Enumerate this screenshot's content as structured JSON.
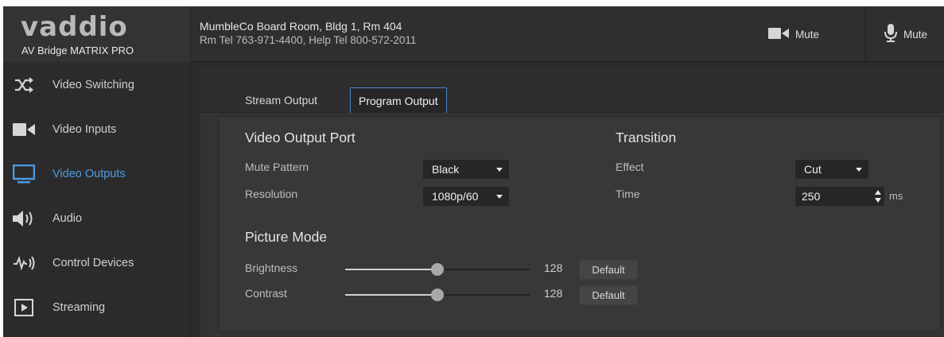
{
  "header": {
    "logo": "vaddio",
    "product": "AV Bridge MATRIX PRO",
    "room_name": "MumbleCo Board Room, Bldg 1, Rm 404",
    "room_phones": "Rm Tel 763-971-4400, Help Tel 800-572-2011",
    "video_mute_label": "Mute",
    "audio_mute_label": "Mute"
  },
  "sidebar": {
    "items": [
      {
        "label": "Video Switching",
        "icon": "shuffle-icon"
      },
      {
        "label": "Video Inputs",
        "icon": "video-camera-icon"
      },
      {
        "label": "Video Outputs",
        "icon": "monitor-icon",
        "active": true
      },
      {
        "label": "Audio",
        "icon": "speaker-icon"
      },
      {
        "label": "Control Devices",
        "icon": "signal-icon"
      },
      {
        "label": "Streaming",
        "icon": "play-box-icon"
      }
    ]
  },
  "tabs": {
    "stream_output": "Stream Output",
    "program_output": "Program Output",
    "selected": "Program Output"
  },
  "video_output_port": {
    "title": "Video Output Port",
    "mute_pattern_label": "Mute Pattern",
    "mute_pattern_value": "Black",
    "resolution_label": "Resolution",
    "resolution_value": "1080p/60"
  },
  "transition": {
    "title": "Transition",
    "effect_label": "Effect",
    "effect_value": "Cut",
    "time_label": "Time",
    "time_value": "250",
    "time_unit": "ms"
  },
  "picture_mode": {
    "title": "Picture Mode",
    "brightness_label": "Brightness",
    "brightness_value": "128",
    "brightness_level": 0.5,
    "contrast_label": "Contrast",
    "contrast_value": "128",
    "contrast_level": 0.5,
    "default_label": "Default"
  },
  "colors": {
    "accent": "#4d9be6",
    "background": "#2b2b2b",
    "panel": "#383838"
  }
}
